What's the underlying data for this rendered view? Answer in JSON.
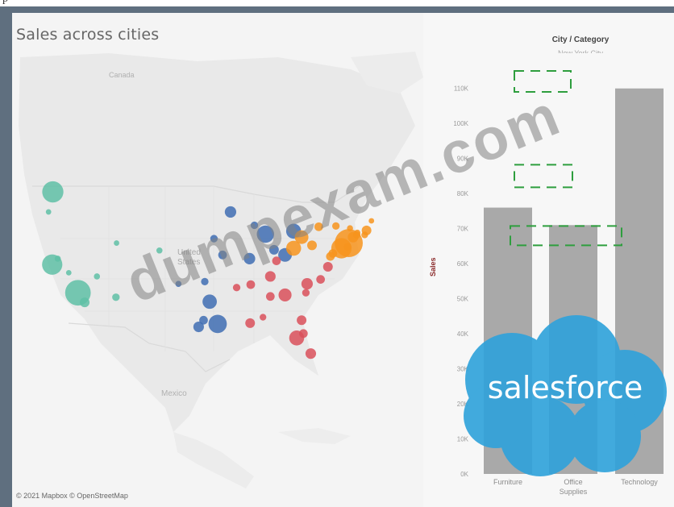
{
  "page_top_char": "p",
  "map": {
    "title": "Sales across cities",
    "labels": {
      "canada": "Canada",
      "united_states": "United\nStates",
      "mexico": "Mexico"
    },
    "copyright": "© 2021 Mapbox © OpenStreetMap",
    "colors": {
      "west": "#5fbfa6",
      "central": "#3f6db3",
      "south": "#d9505a",
      "east": "#f7941d"
    },
    "markers": [
      {
        "lon": -122.3,
        "lat": 47.6,
        "sales": 120,
        "region": "west"
      },
      {
        "lon": -122.4,
        "lat": 37.8,
        "sales": 110,
        "region": "west"
      },
      {
        "lon": -118.2,
        "lat": 34.0,
        "sales": 175,
        "region": "west"
      },
      {
        "lon": -117.1,
        "lat": 32.7,
        "sales": 25,
        "region": "west"
      },
      {
        "lon": -112.0,
        "lat": 33.4,
        "sales": 15,
        "region": "west"
      },
      {
        "lon": -104.9,
        "lat": 39.7,
        "sales": 10,
        "region": "west"
      },
      {
        "lon": -111.9,
        "lat": 40.7,
        "sales": 8,
        "region": "west"
      },
      {
        "lon": -121.5,
        "lat": 38.6,
        "sales": 10,
        "region": "west"
      },
      {
        "lon": -115.1,
        "lat": 36.2,
        "sales": 10,
        "region": "west"
      },
      {
        "lon": -123.0,
        "lat": 44.9,
        "sales": 8,
        "region": "west"
      },
      {
        "lon": -119.7,
        "lat": 36.7,
        "sales": 8,
        "region": "west"
      },
      {
        "lon": -93.3,
        "lat": 44.9,
        "sales": 35,
        "region": "central"
      },
      {
        "lon": -87.6,
        "lat": 41.9,
        "sales": 80,
        "region": "central"
      },
      {
        "lon": -83.0,
        "lat": 42.3,
        "sales": 60,
        "region": "central"
      },
      {
        "lon": -84.4,
        "lat": 39.1,
        "sales": 50,
        "region": "central"
      },
      {
        "lon": -90.2,
        "lat": 38.6,
        "sales": 35,
        "region": "central"
      },
      {
        "lon": -94.6,
        "lat": 39.1,
        "sales": 20,
        "region": "central"
      },
      {
        "lon": -96.7,
        "lat": 32.8,
        "sales": 55,
        "region": "central"
      },
      {
        "lon": -95.4,
        "lat": 29.8,
        "sales": 90,
        "region": "central"
      },
      {
        "lon": -98.5,
        "lat": 29.4,
        "sales": 30,
        "region": "central"
      },
      {
        "lon": -97.7,
        "lat": 30.3,
        "sales": 20,
        "region": "central"
      },
      {
        "lon": -96.0,
        "lat": 41.3,
        "sales": 15,
        "region": "central"
      },
      {
        "lon": -86.2,
        "lat": 39.8,
        "sales": 25,
        "region": "central"
      },
      {
        "lon": -97.5,
        "lat": 35.5,
        "sales": 15,
        "region": "central"
      },
      {
        "lon": -101.8,
        "lat": 35.2,
        "sales": 10,
        "region": "central"
      },
      {
        "lon": -89.4,
        "lat": 43.1,
        "sales": 15,
        "region": "central"
      },
      {
        "lon": -84.4,
        "lat": 33.7,
        "sales": 45,
        "region": "south"
      },
      {
        "lon": -86.8,
        "lat": 36.2,
        "sales": 30,
        "region": "south"
      },
      {
        "lon": -80.8,
        "lat": 35.2,
        "sales": 35,
        "region": "south"
      },
      {
        "lon": -81.7,
        "lat": 30.3,
        "sales": 25,
        "region": "south"
      },
      {
        "lon": -82.5,
        "lat": 27.9,
        "sales": 60,
        "region": "south"
      },
      {
        "lon": -80.2,
        "lat": 25.8,
        "sales": 30,
        "region": "south"
      },
      {
        "lon": -90.1,
        "lat": 29.9,
        "sales": 25,
        "region": "south"
      },
      {
        "lon": -86.8,
        "lat": 33.5,
        "sales": 20,
        "region": "south"
      },
      {
        "lon": -90.0,
        "lat": 35.1,
        "sales": 20,
        "region": "south"
      },
      {
        "lon": -77.4,
        "lat": 37.5,
        "sales": 25,
        "region": "south"
      },
      {
        "lon": -78.6,
        "lat": 35.8,
        "sales": 20,
        "region": "south"
      },
      {
        "lon": -81.0,
        "lat": 34.0,
        "sales": 15,
        "region": "south"
      },
      {
        "lon": -85.8,
        "lat": 38.3,
        "sales": 20,
        "region": "south"
      },
      {
        "lon": -92.3,
        "lat": 34.7,
        "sales": 15,
        "region": "south"
      },
      {
        "lon": -88.0,
        "lat": 30.7,
        "sales": 12,
        "region": "south"
      },
      {
        "lon": -81.4,
        "lat": 28.5,
        "sales": 20,
        "region": "south"
      },
      {
        "lon": -74.0,
        "lat": 40.7,
        "sales": 210,
        "region": "east"
      },
      {
        "lon": -75.2,
        "lat": 40.0,
        "sales": 110,
        "region": "east"
      },
      {
        "lon": -73.3,
        "lat": 41.5,
        "sales": 30,
        "region": "east"
      },
      {
        "lon": -71.1,
        "lat": 42.4,
        "sales": 25,
        "region": "east"
      },
      {
        "lon": -76.6,
        "lat": 39.3,
        "sales": 20,
        "region": "east"
      },
      {
        "lon": -77.0,
        "lat": 38.9,
        "sales": 20,
        "region": "east"
      },
      {
        "lon": -80.0,
        "lat": 40.4,
        "sales": 25,
        "region": "east"
      },
      {
        "lon": -81.7,
        "lat": 41.5,
        "sales": 50,
        "region": "east"
      },
      {
        "lon": -83.0,
        "lat": 40.0,
        "sales": 60,
        "region": "east"
      },
      {
        "lon": -78.9,
        "lat": 42.9,
        "sales": 20,
        "region": "east"
      },
      {
        "lon": -76.1,
        "lat": 43.0,
        "sales": 15,
        "region": "east"
      },
      {
        "lon": -73.8,
        "lat": 42.7,
        "sales": 10,
        "region": "east"
      },
      {
        "lon": -72.7,
        "lat": 41.8,
        "sales": 15,
        "region": "east"
      },
      {
        "lon": -71.4,
        "lat": 41.8,
        "sales": 12,
        "region": "east"
      },
      {
        "lon": -74.2,
        "lat": 40.2,
        "sales": 15,
        "region": "east"
      },
      {
        "lon": -72.6,
        "lat": 42.1,
        "sales": 10,
        "region": "east"
      },
      {
        "lon": -70.3,
        "lat": 43.7,
        "sales": 8,
        "region": "east"
      }
    ]
  },
  "chart_data": {
    "type": "bar",
    "title": "City / Category",
    "subtitle": "New York City",
    "categories": [
      "Furniture",
      "Office\nSupplies",
      "Technology"
    ],
    "values": [
      76000,
      71000,
      110000
    ],
    "ylabel": "Sales",
    "xlabel": "",
    "yticks": [
      "0K",
      "10K",
      "20K",
      "30K",
      "40K",
      "50K",
      "60K",
      "70K",
      "80K",
      "90K",
      "100K",
      "110K"
    ],
    "ylim": [
      0,
      115000
    ],
    "bar_color": "#a9a9a9",
    "highlight_color": "#2e9e3e",
    "highlight_values": [
      112000,
      85000,
      68000
    ],
    "grid": false,
    "legend": "none"
  },
  "watermark": {
    "text": "dumpexam.com"
  },
  "logo": {
    "text": "salesforce",
    "color": "#2aa0da"
  }
}
